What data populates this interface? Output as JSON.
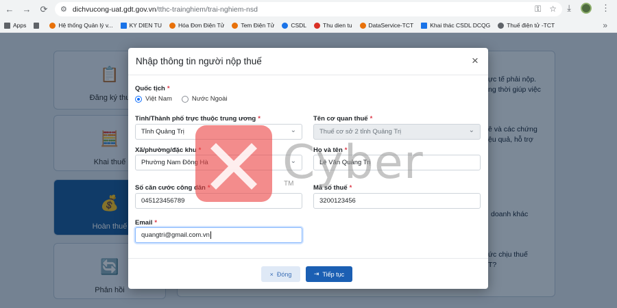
{
  "browser": {
    "url_host": "dichvucong-uat.gdt.gov.vn",
    "url_path": "/tthc-trainghiem/trai-nghiem-nsd",
    "bookmarks": [
      {
        "label": "Apps",
        "icon": "apps-grid-icon",
        "color": "#5f6368"
      },
      {
        "label": "Hệ thống Quản lý v...",
        "icon": "site-icon",
        "color": "#e8710a"
      },
      {
        "label": "KY DIEN TU",
        "icon": "site-icon",
        "color": "#1a73e8"
      },
      {
        "label": "Hóa Đơn Điện Tử",
        "icon": "site-icon",
        "color": "#e8710a"
      },
      {
        "label": "Tem Điện Tử",
        "icon": "site-icon",
        "color": "#e8710a"
      },
      {
        "label": "CSDL",
        "icon": "site-icon",
        "color": "#1a73e8"
      },
      {
        "label": "Thu dien tu",
        "icon": "site-icon",
        "color": "#d93025"
      },
      {
        "label": "DataService-TCT",
        "icon": "site-icon",
        "color": "#e8710a"
      },
      {
        "label": "Khai thác CSDL DCQG",
        "icon": "site-icon",
        "color": "#1a73e8"
      },
      {
        "label": "Thuế điện tử -TCT",
        "icon": "site-icon",
        "color": "#5f6368"
      }
    ],
    "more": "»"
  },
  "background": {
    "cards": [
      {
        "label": "Đăng ký thu",
        "icon": "📋",
        "active": false
      },
      {
        "label": "Khai thuế",
        "icon": "🧮",
        "active": false
      },
      {
        "label": "Hoàn thuế",
        "icon": "💰",
        "active": true
      },
      {
        "label": "Phản hồi",
        "icon": "🔄",
        "active": false
      }
    ],
    "snippets": [
      "ực tế phải nộp.",
      "ng thời giúp việc",
      "ê và các chứng",
      "ệu quả, hỗ trợ",
      "doanh khác",
      "ức chịu thuế",
      "T?"
    ]
  },
  "modal": {
    "title": "Nhập thông tin người nộp thuế",
    "close_icon": "×",
    "required_mark": "*",
    "nationality": {
      "label": "Quốc tịch",
      "options": [
        "Việt Nam",
        "Nước Ngoài"
      ],
      "selected": "Việt Nam"
    },
    "fields": {
      "province": {
        "label": "Tỉnh/Thành phố trực thuộc trung ương",
        "value": "Tỉnh Quảng Trị"
      },
      "tax_office": {
        "label": "Tên cơ quan thuế",
        "value": "Thuế cơ sở 2 tỉnh Quảng Trị"
      },
      "ward": {
        "label": "Xã/phường/đặc khu",
        "value": "Phường Nam Đông Hà"
      },
      "full_name": {
        "label": "Họ và tên",
        "value": "Lê Văn Quảng Trị"
      },
      "citizen_id": {
        "label": "Số căn cước công dân",
        "value": "045123456789"
      },
      "tax_code": {
        "label": "Mã số thuế",
        "value": "3200123456"
      },
      "email": {
        "label": "Email",
        "value": "quangtri@gmail.com.vn"
      }
    },
    "buttons": {
      "close": {
        "icon": "×",
        "label": "Đóng"
      },
      "next": {
        "icon": "⇥",
        "label": "Tiếp tục"
      }
    }
  },
  "watermark": {
    "text": "Cyber",
    "tm": "TM"
  },
  "colors": {
    "primary": "#1b5fb3",
    "required": "#dc3545",
    "watermark_red": "#eb4646"
  }
}
